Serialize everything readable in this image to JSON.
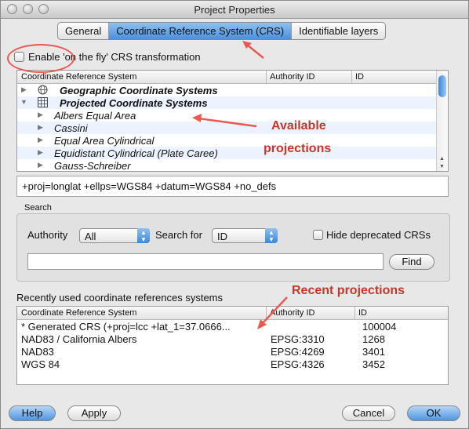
{
  "window": {
    "title": "Project Properties"
  },
  "tabs": [
    {
      "label": "General",
      "active": false
    },
    {
      "label": "Coordinate Reference System (CRS)",
      "active": true
    },
    {
      "label": "Identifiable layers",
      "active": false
    }
  ],
  "otf": {
    "label": "Enable 'on the fly' CRS transformation",
    "checked": false
  },
  "crs_tree": {
    "columns": [
      "Coordinate Reference System",
      "Authority ID",
      "ID"
    ],
    "rows": [
      {
        "label": "Geographic Coordinate Systems",
        "bold": true,
        "icon": "globe-icon",
        "expanded": false
      },
      {
        "label": "Projected Coordinate Systems",
        "bold": true,
        "icon": "grid-icon",
        "expanded": true
      },
      {
        "label": "Albers Equal Area",
        "bold": false
      },
      {
        "label": "Cassini",
        "bold": false
      },
      {
        "label": "Equal Area Cylindrical",
        "bold": false
      },
      {
        "label": "Equidistant Cylindrical (Plate Caree)",
        "bold": false
      },
      {
        "label": "Gauss-Schreiber",
        "bold": false
      }
    ]
  },
  "proj_string": "+proj=longlat +ellps=WGS84 +datum=WGS84 +no_defs",
  "search": {
    "group_label": "Search",
    "authority_label": "Authority",
    "authority_value": "All",
    "search_for_label": "Search for",
    "search_for_value": "ID",
    "hide_deprecated_label": "Hide deprecated CRSs",
    "hide_deprecated_checked": false,
    "query_value": "",
    "find_label": "Find"
  },
  "recent": {
    "label": "Recently used coordinate references systems",
    "columns": [
      "Coordinate Reference System",
      "Authority ID",
      "ID"
    ],
    "rows": [
      {
        "crs": " * Generated CRS (+proj=lcc +lat_1=37.0666...",
        "authority": "",
        "id": "100004"
      },
      {
        "crs": "NAD83 / California Albers",
        "authority": "EPSG:3310",
        "id": "1268"
      },
      {
        "crs": "NAD83",
        "authority": "EPSG:4269",
        "id": "3401"
      },
      {
        "crs": "WGS 84",
        "authority": "EPSG:4326",
        "id": "3452"
      }
    ]
  },
  "buttons": {
    "help": "Help",
    "apply": "Apply",
    "cancel": "Cancel",
    "ok": "OK"
  },
  "annotations": {
    "available_line1": "Available",
    "available_line2": "projections",
    "recent": "Recent projections"
  },
  "colors": {
    "annotation": "#c0392b",
    "selection": "#4b90dc",
    "alt_row": "#edf3fe"
  }
}
